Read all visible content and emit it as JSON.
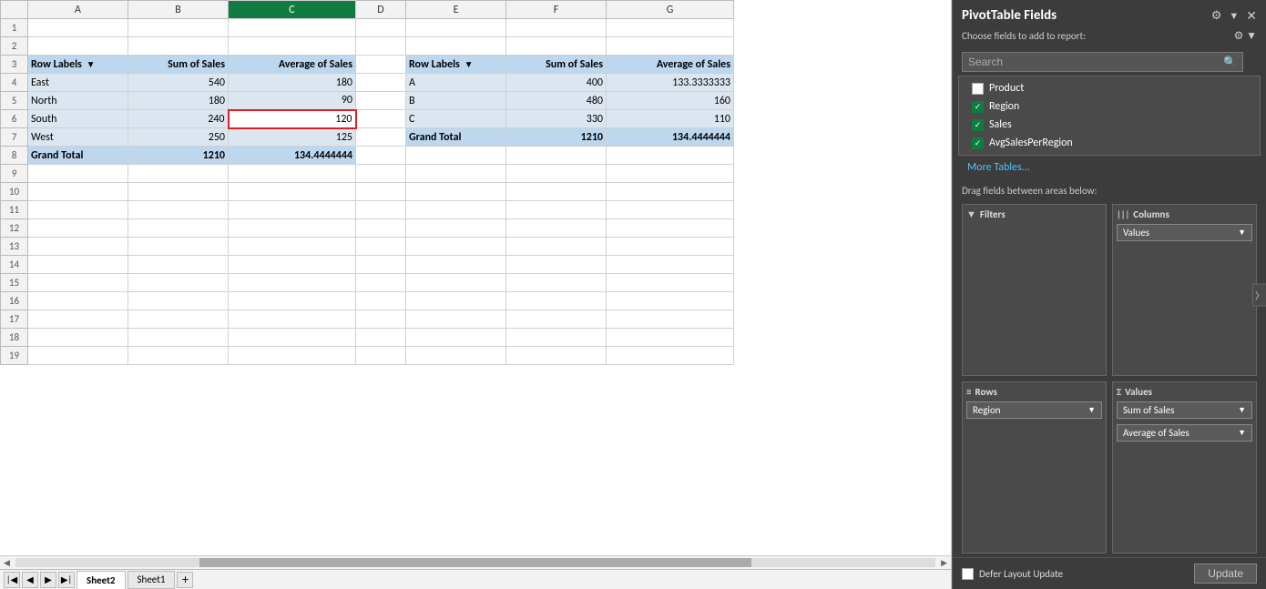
{
  "spreadsheet": {
    "columns": [
      "A",
      "B",
      "C",
      "D",
      "E",
      "F",
      "G"
    ],
    "selected_column": "C",
    "rows": [
      {
        "num": 1,
        "cells": [
          "",
          "",
          "",
          "",
          "",
          "",
          ""
        ]
      },
      {
        "num": 2,
        "cells": [
          "",
          "",
          "",
          "",
          "",
          "",
          ""
        ]
      },
      {
        "num": 3,
        "cells": [
          "Row Labels",
          "Sum of Sales",
          "Average of Sales",
          "",
          "Row Labels",
          "Sum of Sales",
          "Average of Sales"
        ]
      },
      {
        "num": 4,
        "cells": [
          "East",
          "540",
          "180",
          "",
          "A",
          "400",
          "133.3333333"
        ]
      },
      {
        "num": 5,
        "cells": [
          "North",
          "180",
          "90",
          "",
          "B",
          "480",
          "160"
        ]
      },
      {
        "num": 6,
        "cells": [
          "South",
          "240",
          "120",
          "",
          "C",
          "330",
          "110"
        ]
      },
      {
        "num": 7,
        "cells": [
          "West",
          "250",
          "125",
          "",
          "Grand Total",
          "1210",
          "134.4444444"
        ]
      },
      {
        "num": 8,
        "cells": [
          "Grand Total",
          "1210",
          "134.4444444",
          "",
          "",
          "",
          ""
        ]
      },
      {
        "num": 9,
        "cells": [
          "",
          "",
          "",
          "",
          "",
          "",
          ""
        ]
      },
      {
        "num": 10,
        "cells": [
          "",
          "",
          "",
          "",
          "",
          "",
          ""
        ]
      },
      {
        "num": 11,
        "cells": [
          "",
          "",
          "",
          "",
          "",
          "",
          ""
        ]
      },
      {
        "num": 12,
        "cells": [
          "",
          "",
          "",
          "",
          "",
          "",
          ""
        ]
      },
      {
        "num": 13,
        "cells": [
          "",
          "",
          "",
          "",
          "",
          "",
          ""
        ]
      },
      {
        "num": 14,
        "cells": [
          "",
          "",
          "",
          "",
          "",
          "",
          ""
        ]
      },
      {
        "num": 15,
        "cells": [
          "",
          "",
          "",
          "",
          "",
          "",
          ""
        ]
      },
      {
        "num": 16,
        "cells": [
          "",
          "",
          "",
          "",
          "",
          "",
          ""
        ]
      },
      {
        "num": 17,
        "cells": [
          "",
          "",
          "",
          "",
          "",
          "",
          ""
        ]
      },
      {
        "num": 18,
        "cells": [
          "",
          "",
          "",
          "",
          "",
          "",
          ""
        ]
      },
      {
        "num": 19,
        "cells": [
          "",
          "",
          "",
          "",
          "",
          "",
          ""
        ]
      }
    ],
    "selected_cell": {
      "row": 6,
      "col": 2
    },
    "sheet_tabs": [
      "Sheet2",
      "Sheet1"
    ],
    "active_sheet": "Sheet2"
  },
  "pivot_panel": {
    "title": "PivotTable Fields",
    "subtitle": "Choose fields to add to report:",
    "search_placeholder": "Search",
    "fields": [
      {
        "label": "Product",
        "checked": false
      },
      {
        "label": "Region",
        "checked": true
      },
      {
        "label": "Sales",
        "checked": true
      },
      {
        "label": "AvgSalesPerRegion",
        "checked": true
      }
    ],
    "more_tables": "More Tables...",
    "areas_label": "Drag fields between areas below:",
    "filters_label": "Filters",
    "columns_label": "Columns",
    "rows_label": "Rows",
    "values_label": "Values",
    "columns_values_item": "Values",
    "rows_region_item": "Region",
    "values_items": [
      "Sum of Sales",
      "Average of Sales"
    ],
    "defer_label": "Defer Layout Update",
    "update_label": "Update",
    "chevron_down": "▼",
    "chevron_left": "〈",
    "filter_icon": "▼",
    "columns_icon": "|||",
    "rows_icon": "≡",
    "sigma_icon": "Σ"
  }
}
